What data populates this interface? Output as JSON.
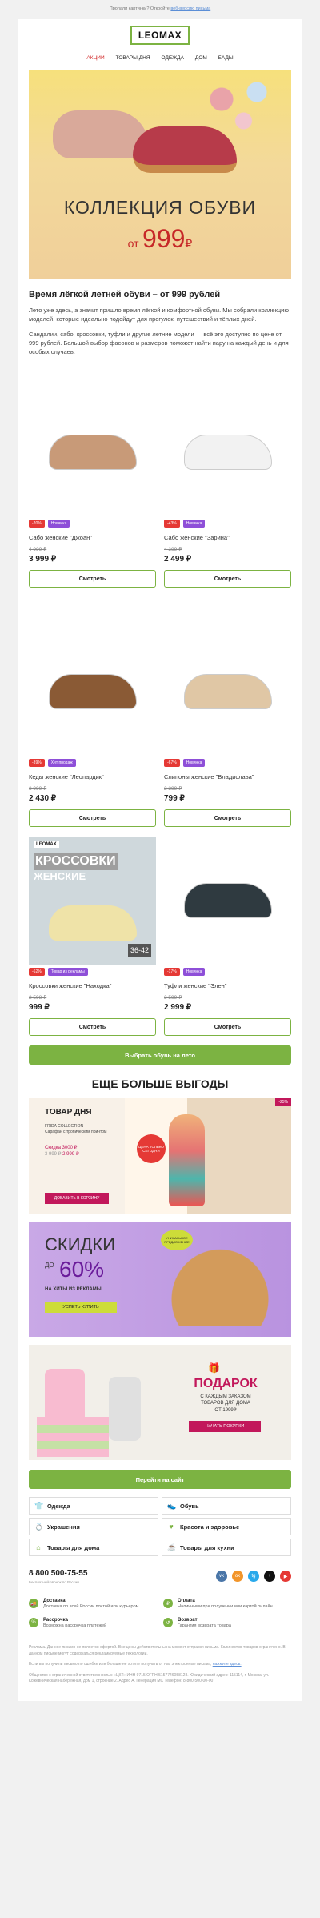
{
  "preheader": {
    "text": "Пропали картинки? Откройте",
    "link": "веб-версию письма"
  },
  "logo": "LEOMAX",
  "nav": [
    "АКЦИИ",
    "ТОВАРЫ ДНЯ",
    "ОДЕЖДА",
    "ДОМ",
    "БАДЫ"
  ],
  "hero": {
    "title": "КОЛЛЕКЦИЯ ОБУВИ",
    "from": "от",
    "price": "999",
    "currency": "₽"
  },
  "intro": {
    "title": "Время лёгкой летней обуви – от 999 рублей",
    "p1": "Лето уже здесь, а значит пришло время лёгкой и комфортной обуви. Мы собрали коллекцию моделей, которые идеально подойдут для прогулок, путешествий и тёплых дней.",
    "p2": "Сандалии, сабо, кроссовки, туфли и другие летние модели — всё это доступно по цене от 999 рублей. Большой выбор фасонов и размеров поможет найти пару на каждый день и для особых случаев."
  },
  "products": [
    {
      "discount": "-20%",
      "tag": "Новинка",
      "name": "Сабо женские \"Джоан\"",
      "old": "4 999 ₽",
      "price": "3 999 ₽",
      "btn": "Смотреть",
      "color": "#c89a78"
    },
    {
      "discount": "-43%",
      "tag": "Новинка",
      "name": "Сабо женские \"Зарина\"",
      "old": "4 399 ₽",
      "price": "2 499 ₽",
      "btn": "Смотреть",
      "color": "#f2f2f2"
    },
    {
      "discount": "-39%",
      "tag": "Хит продаж",
      "name": "Кеды женские \"Леопардик\"",
      "old": "3 999 ₽",
      "price": "2 430 ₽",
      "btn": "Смотреть",
      "color": "#8a5a35"
    },
    {
      "discount": "-67%",
      "tag": "Новинка",
      "name": "Слипоны женские \"Владислава\"",
      "old": "2 399 ₽",
      "price": "799 ₽",
      "btn": "Смотреть",
      "color": "#e0c7a5"
    },
    {
      "discount": "-62%",
      "tag": "Товар из рекламы",
      "name": "Кроссовки женские \"Находка\"",
      "old": "2 598 ₽",
      "price": "999 ₽",
      "btn": "Смотреть",
      "color": "#efe3a8",
      "promo": {
        "brand": "LEOMAX",
        "line1": "КРОССОВКИ",
        "line2": "ЖЕНСКИЕ",
        "sizes": "36-42"
      }
    },
    {
      "discount": "-17%",
      "tag": "Новинка",
      "name": "Туфли женские \"Элен\"",
      "old": "3 599 ₽",
      "price": "2 999 ₽",
      "btn": "Смотреть",
      "color": "#2f3a40"
    }
  ],
  "cta_summer": "Выбрать обувь на лето",
  "section_title": "ЕЩЕ БОЛЬШЕ ВЫГОДЫ",
  "banner1": {
    "title": "ТОВАР ДНЯ",
    "line1": "FRIDA COLLECTION",
    "line2": "Сарафан с тропическим принтом",
    "line3": "Скидка 3000 ₽",
    "old": "3 999 ₽",
    "price": "2 999 ₽",
    "btn": "ДОБАВИТЬ В КОРЗИНУ",
    "circle": "ЦЕНА ТОЛЬКО СЕГОДНЯ",
    "pct": "-25%"
  },
  "banner2": {
    "title": "СКИДКИ",
    "do": "ДО",
    "pct": "60%",
    "sub": "НА ХИТЫ ИЗ РЕКЛАМЫ",
    "btn": "УСПЕТЬ КУПИТЬ",
    "label": "УНИКАЛЬНОЕ ПРЕДЛОЖЕНИЕ"
  },
  "banner3": {
    "title": "ПОДАРОК",
    "s1": "С КАЖДЫМ ЗАКАЗОМ",
    "s2": "ТОВАРОВ ДЛЯ ДОМА",
    "s3": "ОТ 1999₽",
    "btn": "НАЧАТЬ ПОКУПКИ"
  },
  "cta_site": "Перейти на сайт",
  "categories": [
    {
      "icon": "👕",
      "label": "Одежда"
    },
    {
      "icon": "👟",
      "label": "Обувь"
    },
    {
      "icon": "💍",
      "label": "Украшения"
    },
    {
      "icon": "♥",
      "label": "Красота и здоровье"
    },
    {
      "icon": "⌂",
      "label": "Товары для дома"
    },
    {
      "icon": "☕",
      "label": "Товары для кухни"
    }
  ],
  "footer": {
    "phone": "8 800 500-75-55",
    "phone_sub": "Бесплатный звонок по России",
    "socials": [
      {
        "t": "vk",
        "c": "#4a76a8"
      },
      {
        "t": "ok",
        "c": "#f2952a"
      },
      {
        "t": "tg",
        "c": "#29a9eb"
      },
      {
        "t": "+",
        "c": "#111"
      },
      {
        "t": "▶",
        "c": "#e53935"
      }
    ],
    "features": [
      {
        "icon": "🚚",
        "title": "Доставка",
        "desc": "Доставка по всей России почтой или курьером"
      },
      {
        "icon": "₽",
        "title": "Оплата",
        "desc": "Наличными при получении или картой онлайн"
      },
      {
        "icon": "%",
        "title": "Рассрочка",
        "desc": "Возможна рассрочка платежей"
      },
      {
        "icon": "↺",
        "title": "Возврат",
        "desc": "Гарантия возврата товара"
      }
    ],
    "legal1": "Реклама. Данное письмо не является офертой. Все цены действительны на момент отправки письма. Количество товаров ограничено. В данном письме могут содержаться рекламируемые технологии.",
    "legal2": "Если вы получили письмо по ошибке или больше не хотите получать от нас электронные письма,",
    "unsubscribe": "нажмите здесь.",
    "legal3": "Общество с ограниченной ответственностью «ЦКТ» ИНН 9715 ОГРН 5157746058128. Юридический адрес: 115114, г. Москва, ул. Кожевническая набережная, дом 1, строение 2. Адрес А. Генерация МС Телефон: 8-800-500-00-00"
  }
}
